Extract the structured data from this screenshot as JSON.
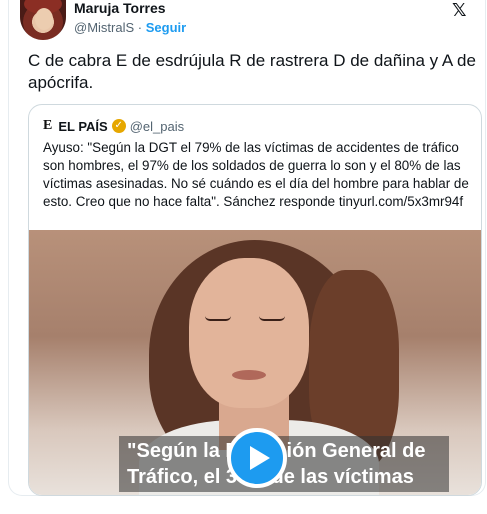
{
  "tweet": {
    "author_name": "Maruja Torres",
    "author_handle": "@MistralS",
    "separator": "·",
    "follow_label": "Seguir",
    "platform_logo": "𝕏",
    "text": "C de cabra E de esdrújula R de rastrera D de dañina y A de apócrifa."
  },
  "quoted": {
    "source_logo": "E",
    "source_name": "EL PAÍS",
    "verified_mark": "✓",
    "source_handle": "@el_pais",
    "text": "Ayuso: \"Según la DGT el 79% de las víctimas de accidentes de tráfico son hombres, el 97% de los soldados de guerra lo son y el 80% de las víctimas asesinadas. No sé cuándo es el día del hombre para hablar de esto. Creo que no hace falta\". Sánchez responde tinyurl.com/5x3mr94f",
    "video_caption": "\"Según la Dirección General de Tráfico, el 39% de las víctimas"
  },
  "icons": {
    "avatar": "avatar-icon",
    "play": "play-icon",
    "verified": "verified-badge-icon",
    "logo": "x-logo-icon"
  },
  "colors": {
    "accent": "#1d9bf0",
    "verified": "#e6a700",
    "muted": "#536471"
  }
}
